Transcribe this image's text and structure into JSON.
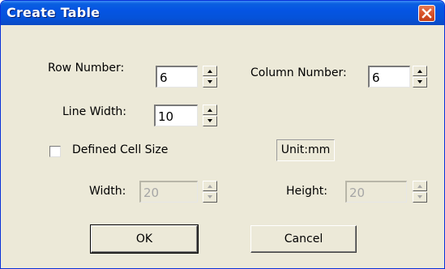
{
  "window": {
    "title": "Create Table",
    "close_icon": "close-icon"
  },
  "fields": {
    "row_number": {
      "label": "Row Number:",
      "value": "6"
    },
    "column_number": {
      "label": "Column Number:",
      "value": "6"
    },
    "line_width": {
      "label": "Line Width:",
      "value": "10"
    }
  },
  "defined_cell_size": {
    "label": "Defined Cell Size",
    "checked": false
  },
  "unit": {
    "label": "Unit:mm"
  },
  "cell": {
    "width": {
      "label": "Width:",
      "value": "20",
      "disabled": true
    },
    "height": {
      "label": "Height:",
      "value": "20",
      "disabled": true
    }
  },
  "buttons": {
    "ok": "OK",
    "cancel": "Cancel"
  },
  "colors": {
    "title_bar": "#0554e3",
    "close": "#d9532b",
    "dialog_bg": "#ece9d8"
  }
}
